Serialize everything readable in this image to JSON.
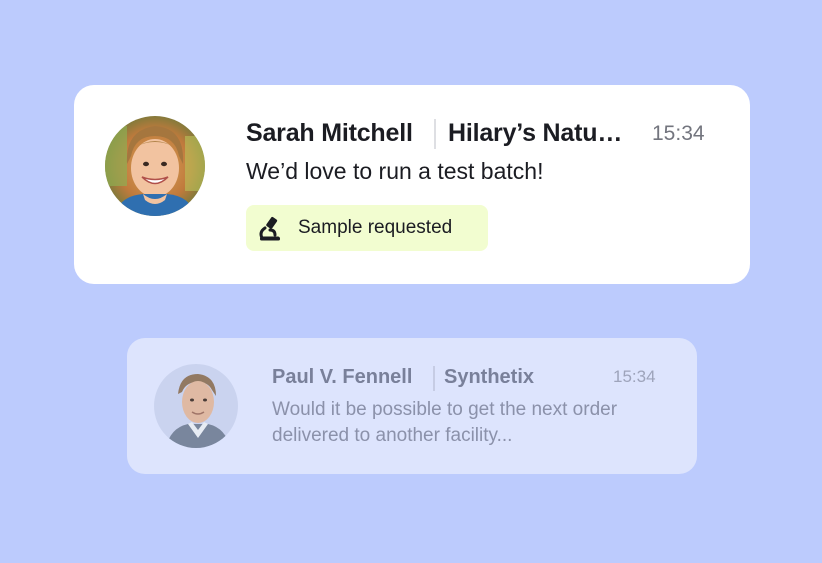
{
  "colors": {
    "background": "#bccbfd",
    "primary_card": "#ffffff",
    "secondary_card": "#dde4fd",
    "tag_background": "#f2fdd0",
    "primary_text": "#1b1c22",
    "muted_text": "#79809a"
  },
  "conversations": [
    {
      "sender": "Sarah Mitchell",
      "company": "Hilary’s Natural Foods",
      "time": "15:34",
      "message": "We’d love to run a test batch!",
      "tag": {
        "icon": "microscope-icon",
        "label": "Sample requested"
      }
    },
    {
      "sender": "Paul V. Fennell",
      "company": "Synthetix",
      "time": "15:34",
      "message": "Would it be possible to get the next order delivered to another facility..."
    }
  ]
}
